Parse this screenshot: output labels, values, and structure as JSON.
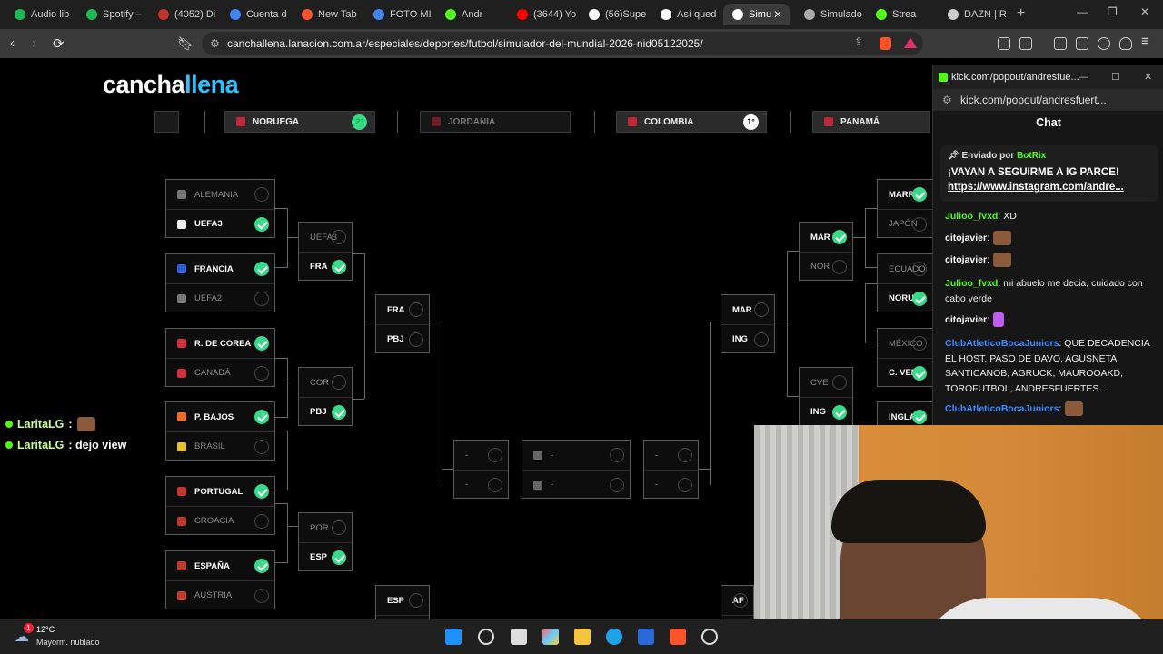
{
  "browser": {
    "tabs": [
      {
        "label": "Audio lib",
        "color": "#1db954"
      },
      {
        "label": "Spotify –",
        "color": "#1db954"
      },
      {
        "label": "(4052) Di",
        "color": "#c4302b"
      },
      {
        "label": "Cuenta d",
        "color": "#4285f4"
      },
      {
        "label": "New Tab",
        "color": "#fb542b"
      },
      {
        "label": "FOTO MI",
        "color": "#4285f4"
      },
      {
        "label": "Andr",
        "color": "#53fc18"
      },
      {
        "label": "(3644) Yo",
        "color": "#ff0000"
      },
      {
        "label": "(56)Supe",
        "color": "#ffffff"
      },
      {
        "label": "Así qued",
        "color": "#ffffff"
      },
      {
        "label": "Simu",
        "color": "#ffffff"
      },
      {
        "label": "Simulado",
        "color": "#aaaaaa"
      },
      {
        "label": "Strea",
        "color": "#53fc18"
      },
      {
        "label": "DAZN | R",
        "color": "#cccccc"
      }
    ],
    "url": "canchallena.lanacion.com.ar/especiales/deportes/futbol/simulador-del-mundial-2026-nid05122025/"
  },
  "page": {
    "logo_a": "cancha",
    "logo_b": "llena",
    "top_row": [
      {
        "team": "NORUEGA",
        "badge": "2°",
        "dim": false
      },
      {
        "team": "JORDANIA",
        "badge": "",
        "dim": true
      },
      {
        "team": "COLOMBIA",
        "badge": "1°",
        "dim": false
      },
      {
        "team": "PANAMÁ",
        "badge": "",
        "dim": false
      }
    ],
    "round32_left": [
      {
        "a": "ALEMANIA",
        "b": "UEFA3",
        "winner": "b",
        "ca": "#777777",
        "cb": "#eeeeee"
      },
      {
        "a": "FRANCIA",
        "b": "UEFA2",
        "winner": "a",
        "ca": "#2a5bd7",
        "cb": "#777777"
      },
      {
        "a": "R. DE COREA",
        "b": "CANADÁ",
        "winner": "a",
        "ca": "#d62d3b",
        "cb": "#d62d3b"
      },
      {
        "a": "P. BAJOS",
        "b": "BRASIL",
        "winner": "a",
        "ca": "#f36c21",
        "cb": "#e6c229"
      },
      {
        "a": "PORTUGAL",
        "b": "CROACIA",
        "winner": "a",
        "ca": "#c0392b",
        "cb": "#c0392b"
      },
      {
        "a": "ESPAÑA",
        "b": "AUSTRIA",
        "winner": "a",
        "ca": "#c0392b",
        "cb": "#c0392b"
      }
    ],
    "round16_left": [
      {
        "a": "UEFA3",
        "b": "FRA",
        "winner": "b"
      },
      {
        "a": "COR",
        "b": "PBJ",
        "winner": "b"
      },
      {
        "a": "POR",
        "b": "ESP",
        "winner": "b"
      }
    ],
    "qf_left": [
      {
        "a": "FRA",
        "b": "PBJ"
      },
      {
        "a": "ESP",
        "b": ""
      }
    ],
    "round32_right": [
      {
        "a": "MARRU",
        "b": "JAPÓN",
        "winner": "a"
      },
      {
        "a": "ECUADO",
        "b": "NORUEG",
        "winner": "b"
      },
      {
        "a": "MÉXICO",
        "b": "C. VERD",
        "winner": "b"
      },
      {
        "a": "INGLAT",
        "b": "",
        "winner": "a"
      }
    ],
    "round16_right": [
      {
        "a": "MAR",
        "b": "NOR",
        "winner": "a"
      },
      {
        "a": "CVE",
        "b": "ING",
        "winner": "b"
      }
    ],
    "qf_right": [
      {
        "a": "MAR",
        "b": "ING"
      },
      {
        "a": "AF",
        "b": ""
      }
    ],
    "center_placeholder": "-"
  },
  "stream_overlay": [
    {
      "user": "LaritaLG",
      "text": ":"
    },
    {
      "user": "LaritaLG",
      "text": ": dejo view"
    }
  ],
  "popout": {
    "title": "kick.com/popout/andresfue...",
    "url": "kick.com/popout/andresfuert...",
    "chat_label": "Chat",
    "pinned_by": "Enviado por",
    "pinned_bot": "BotRix",
    "pinned_msg": "¡VAYAN A SEGUIRME A IG PARCE!",
    "pinned_link": "https://www.instagram.com/andre...",
    "messages": [
      {
        "user": "Julioo_fvxd",
        "text": ": XD",
        "color": "#53fc18"
      },
      {
        "user": "citojavier",
        "text": ":",
        "color": "#ffffff"
      },
      {
        "user": "citojavier",
        "text": ":",
        "color": "#ffffff"
      },
      {
        "user": "Julioo_fvxd",
        "text": ": mi abuelo me decia, cuidado con cabo verde",
        "color": "#53fc18"
      },
      {
        "user": "citojavier",
        "text": ":",
        "color": "#ffffff"
      },
      {
        "user": "ClubAtleticoBocaJuniors",
        "text": ": QUE DECADENCIA EL HOST, PASO DE DAVO, AGUSNETA, SANTICANOB, AGRUCK, MAUROOAKD, TOROFUTBOL, ANDRESFUERTES...",
        "color": "#3a8cff"
      },
      {
        "user": "ClubAtleticoBocaJuniors",
        "text": ":",
        "color": "#3a8cff"
      }
    ]
  },
  "taskbar": {
    "weather_temp": "12°C",
    "weather_desc": "Mayorm. nublado",
    "weather_badge": "1"
  }
}
